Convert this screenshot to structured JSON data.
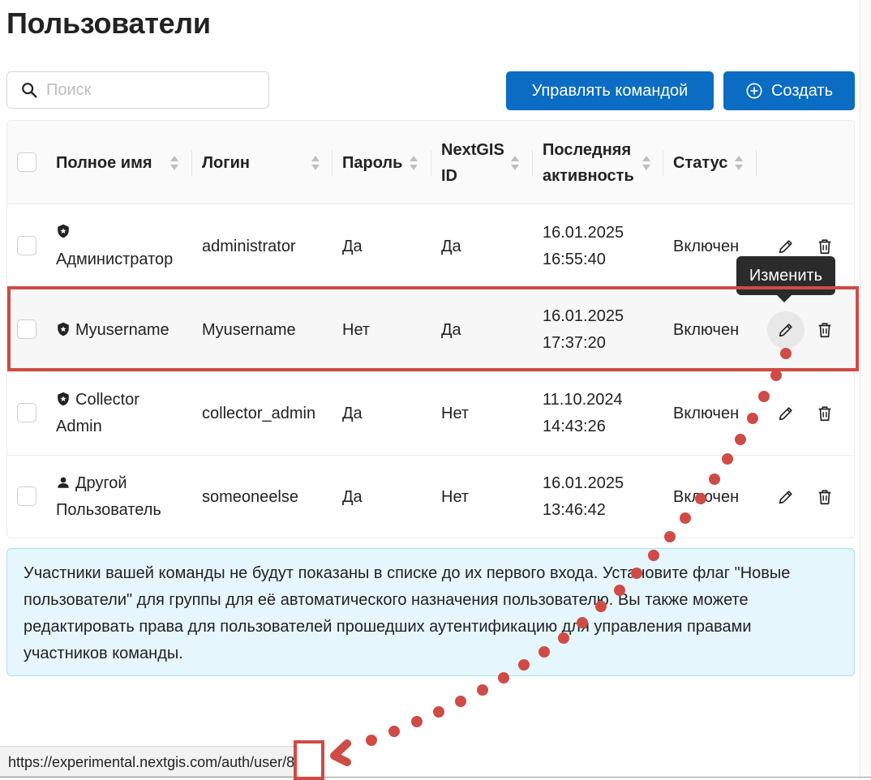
{
  "page": {
    "title": "Пользователи"
  },
  "search": {
    "placeholder": "Поиск"
  },
  "toolbar": {
    "team_label": "Управлять командой",
    "create_label": "Создать"
  },
  "table": {
    "columns": [
      "Полное имя",
      "Логин",
      "Пароль",
      "NextGIS ID",
      "Последняя активность",
      "Статус"
    ],
    "header_lines": {
      "nextgis_1": "NextGIS",
      "nextgis_2": "ID",
      "activity_1": "Последняя",
      "activity_2": "активность"
    },
    "rows": [
      {
        "name_icon": "shield-icon",
        "name_line1": "",
        "name_line2": "Администратор",
        "login": "administrator",
        "password": "Да",
        "nextgis_id": "Да",
        "date": "16.01.2025",
        "time": "16:55:40",
        "status": "Включен"
      },
      {
        "name_icon": "shield-icon",
        "name_line1": "Myusername",
        "name_line2": "",
        "login": "Myusername",
        "password": "Нет",
        "nextgis_id": "Да",
        "date": "16.01.2025",
        "time": "17:37:20",
        "status": "Включен"
      },
      {
        "name_icon": "shield-icon",
        "name_line1": "Collector",
        "name_line2": "Admin",
        "login": "collector_admin",
        "password": "Да",
        "nextgis_id": "Нет",
        "date": "11.10.2024",
        "time": "14:43:26",
        "status": "Включен"
      },
      {
        "name_icon": "user-icon",
        "name_line1": "Другой",
        "name_line2": "Пользователь",
        "login": "someoneelse",
        "password": "Да",
        "nextgis_id": "Нет",
        "date": "16.01.2025",
        "time": "13:46:42",
        "status": "Включен"
      }
    ]
  },
  "tooltip": {
    "text": "Изменить"
  },
  "info": {
    "text": "Участники вашей команды не будут показаны в списке до их первого входа. Установите флаг \"Новые пользователи\" для группы для её автоматического назначения пользователю. Вы также можете редактировать права для пользователей прошедших аутентификацию для управления правами участников команды."
  },
  "statusbar": {
    "url": "https://experimental.nextgis.com/auth/user/8"
  },
  "colors": {
    "accent": "#0a6cc2",
    "annotation": "#cf4b45",
    "info_bg": "#e6f6fd",
    "info_border": "#a9dff3"
  }
}
